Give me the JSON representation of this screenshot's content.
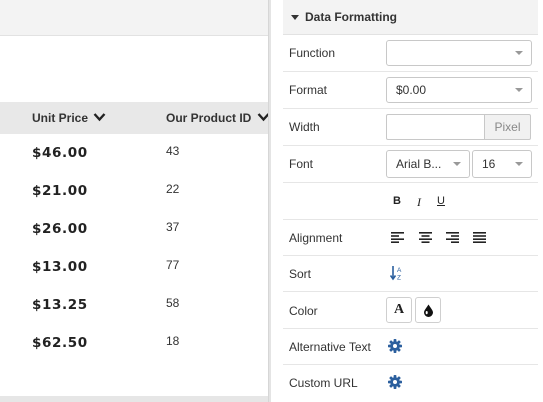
{
  "table": {
    "columns": [
      "Unit Price",
      "Our Product ID"
    ],
    "rows": [
      {
        "price": "$46.00",
        "id": "43"
      },
      {
        "price": "$21.00",
        "id": "22"
      },
      {
        "price": "$26.00",
        "id": "37"
      },
      {
        "price": "$13.00",
        "id": "77"
      },
      {
        "price": "$13.25",
        "id": "58"
      },
      {
        "price": "$62.50",
        "id": "18"
      }
    ]
  },
  "panel": {
    "title": "Data Formatting",
    "function_label": "Function",
    "function_value": "",
    "format_label": "Format",
    "format_value": "$0.00",
    "width_label": "Width",
    "width_value": "",
    "width_unit": "Pixel",
    "font_label": "Font",
    "font_family_value": "Arial B...",
    "font_size_value": "16",
    "bold": "B",
    "italic": "I",
    "underline": "U",
    "alignment_label": "Alignment",
    "sort_label": "Sort",
    "color_label": "Color",
    "text_color_glyph": "A",
    "alt_text_label": "Alternative Text",
    "custom_url_label": "Custom URL"
  },
  "colors": {
    "accent_icon": "#2b5f9e",
    "header_bg": "#e8e8e8",
    "panel_header_bg": "#f3f3f3"
  },
  "icons": [
    "chevron-down-icon",
    "caret-down-icon",
    "align-left-icon",
    "align-center-icon",
    "align-right-icon",
    "align-justify-icon",
    "sort-az-icon",
    "text-color-icon",
    "fill-color-icon",
    "gear-icon"
  ]
}
